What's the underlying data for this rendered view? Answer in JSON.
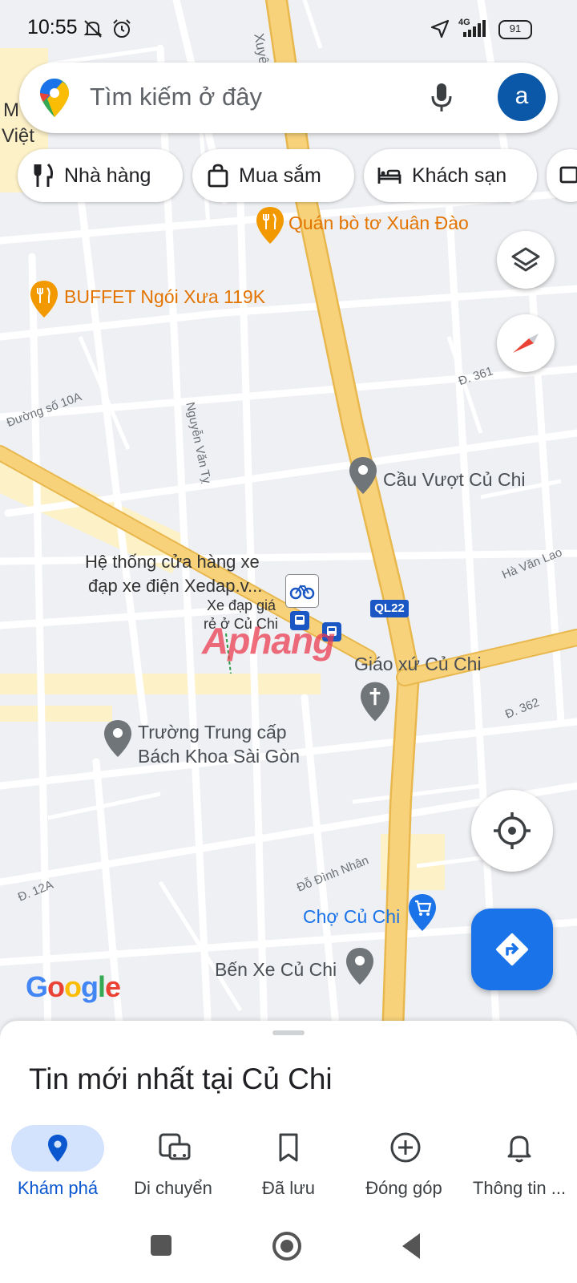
{
  "status_bar": {
    "time": "10:55",
    "network": "4G",
    "battery": "91",
    "icons": [
      "mute-icon",
      "alarm-icon",
      "location-arrow-icon",
      "signal-icon",
      "battery-icon"
    ]
  },
  "search": {
    "placeholder": "Tìm kiếm ở đây",
    "avatar_letter": "a"
  },
  "chips": [
    {
      "label": "Nhà hàng",
      "icon": "restaurant-icon"
    },
    {
      "label": "Mua sắm",
      "icon": "shopping-bag-icon"
    },
    {
      "label": "Khách sạn",
      "icon": "hotel-icon"
    }
  ],
  "map": {
    "pois": [
      {
        "name": "Quán bò tơ Xuân Đào",
        "icon": "restaurant-pin-icon",
        "color": "#e37400"
      },
      {
        "name": "BUFFET Ngói Xưa 119K",
        "icon": "restaurant-pin-icon",
        "color": "#e37400"
      },
      {
        "name": "Cầu Vượt Củ Chi",
        "icon": "place-pin-icon",
        "color": "#5f6368"
      },
      {
        "name_line1": "Hệ thống cửa hàng xe",
        "name_line2": "đạp xe điện Xedap.v...",
        "icon": "bicycle-icon"
      },
      {
        "name_line1": "Xe đạp giá",
        "name_line2": "rẻ ở Củ Chi",
        "icon": "bus-stop-icon"
      },
      {
        "name": "Giáo xứ Củ Chi",
        "icon": "church-pin-icon",
        "color": "#5f6368"
      },
      {
        "name_line1": "Trường Trung cấp",
        "name_line2": "Bách Khoa Sài Gòn",
        "icon": "school-pin-icon",
        "color": "#5f6368"
      },
      {
        "name": "Chợ Củ Chi",
        "icon": "shopping-pin-icon",
        "color": "#1a73e8"
      },
      {
        "name": "Bến Xe Củ Chi",
        "icon": "place-pin-icon",
        "color": "#5f6368"
      }
    ],
    "partial_labels": [
      "M",
      "Việt"
    ],
    "streets": [
      "Xuyê",
      "Đường số 10A",
      "Nguyễn Văn Tỵ",
      "Đ. 361",
      "Hà Văn Lao",
      "Đ. 362",
      "Đ. 12A",
      "Đỗ Đình Nhân"
    ],
    "route_badge": "QL22",
    "watermark": "Aphang",
    "google_logo": "Google"
  },
  "sheet": {
    "title": "Tin mới nhất tại Củ Chi"
  },
  "nav": [
    {
      "label": "Khám phá",
      "icon": "explore-pin-icon",
      "active": true
    },
    {
      "label": "Di chuyển",
      "icon": "commute-icon"
    },
    {
      "label": "Đã lưu",
      "icon": "bookmark-icon"
    },
    {
      "label": "Đóng góp",
      "icon": "add-circle-icon"
    },
    {
      "label": "Thông tin ...",
      "icon": "bell-icon"
    }
  ],
  "colors": {
    "accent": "#1a73e8",
    "road_major": "#f8d27a",
    "map_bg": "#eef0f3"
  }
}
